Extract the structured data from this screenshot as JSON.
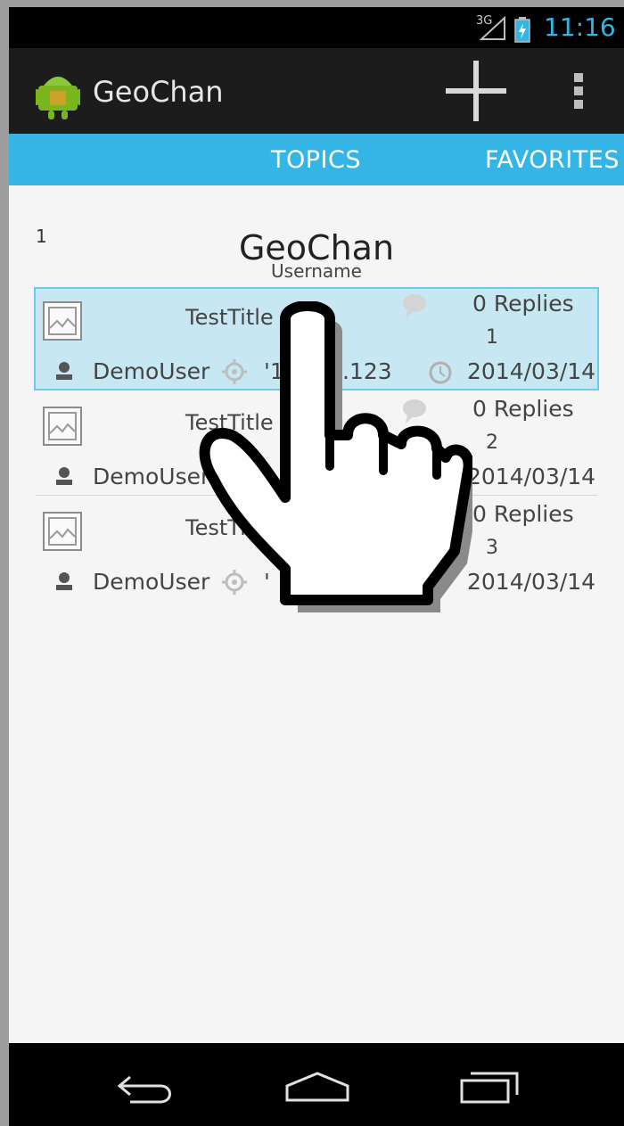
{
  "status_bar": {
    "network": "3G",
    "time": "11:16"
  },
  "action_bar": {
    "app_title": "GeoChan",
    "logo_icon": "android-app-icon",
    "add_icon": "plus-icon",
    "overflow_icon": "overflow-menu-icon"
  },
  "tabs": [
    {
      "label": "TOPICS"
    },
    {
      "label": "FAVORITES"
    }
  ],
  "content": {
    "page_index": "1",
    "header_title": "GeoChan",
    "header_subtitle": "Username",
    "topics": [
      {
        "title": "TestTitle",
        "replies": "0 Replies",
        "number": "1",
        "user": "DemoUser",
        "location": "'1",
        "location_tail": ".123",
        "date": "2014/03/14",
        "selected": true
      },
      {
        "title": "TestTitle",
        "replies": "0 Replies",
        "number": "2",
        "user": "DemoUser",
        "location": "",
        "location_tail": "",
        "date": "2014/03/14",
        "selected": false
      },
      {
        "title": "TestTi",
        "replies": "0 Replies",
        "number": "3",
        "user": "DemoUser",
        "location": "'",
        "location_tail": "",
        "date": "2014/03/14",
        "selected": false
      }
    ]
  },
  "nav_bar": {
    "back_icon": "back-icon",
    "home_icon": "home-icon",
    "recents_icon": "recent-apps-icon"
  },
  "colors": {
    "accent": "#33b5e5",
    "tab_bar": "#35b5e6",
    "selected_row": "#c7e7f3"
  }
}
